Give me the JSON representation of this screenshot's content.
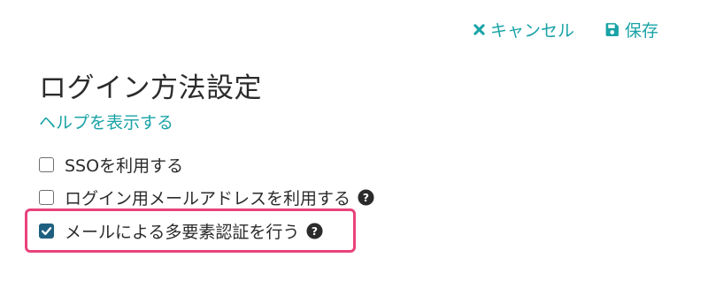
{
  "toolbar": {
    "cancel_label": "キャンセル",
    "save_label": "保存",
    "cancel_icon": "close-icon",
    "save_icon": "floppy-disk-icon"
  },
  "title": "ログイン方法設定",
  "help_link": "ヘルプを表示する",
  "options": [
    {
      "label": "SSOを利用する",
      "checked": false,
      "has_help": false
    },
    {
      "label": "ログイン用メールアドレスを利用する",
      "checked": false,
      "has_help": true
    },
    {
      "label": "メールによる多要素認証を行う",
      "checked": true,
      "has_help": true
    }
  ],
  "colors": {
    "accent": "#1aa3a6",
    "checkbox_checked": "#1f5f80",
    "highlight": "#e8427c",
    "text": "#2b2b2b"
  }
}
